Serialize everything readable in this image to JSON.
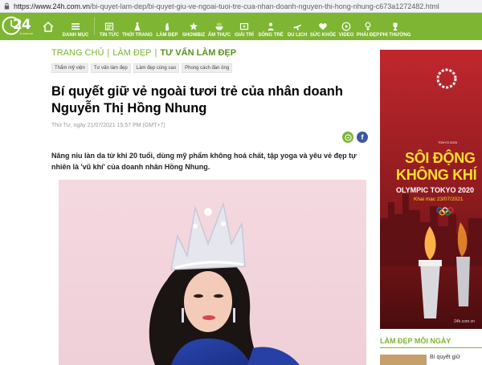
{
  "browser": {
    "url_host": "https://www.24h.com.vn",
    "url_path": "/bi-quyet-lam-dep/bi-quyet-giu-ve-ngoai-tuoi-tre-cua-nhan-doanh-nguyen-thi-hong-nhung-c673a1272482.html"
  },
  "nav": {
    "logo_text": "24",
    "logo_sub": "h.com.vn",
    "menu_label": "DANH MỤC",
    "items": [
      {
        "label": "TIN TỨC",
        "icon": "newspaper-icon"
      },
      {
        "label": "THỜI TRANG",
        "icon": "dress-icon"
      },
      {
        "label": "LÀM ĐẸP",
        "icon": "lipstick-icon"
      },
      {
        "label": "SHOWBIZ",
        "icon": "star-icon"
      },
      {
        "label": "ẨM THỰC",
        "icon": "bowl-icon"
      },
      {
        "label": "GIẢI TRÍ",
        "icon": "film-icon"
      },
      {
        "label": "SỐNG TRẺ",
        "icon": "person-icon"
      },
      {
        "label": "DU LỊCH",
        "icon": "plane-icon"
      },
      {
        "label": "SỨC KHỎE",
        "icon": "heart-icon"
      },
      {
        "label": "VIDEO",
        "icon": "play-icon"
      },
      {
        "label": "PHÁI ĐẸP",
        "icon": "female-icon"
      },
      {
        "label": "PHI THƯỜNG",
        "icon": "trophy-icon"
      }
    ],
    "accent": "#7eb532"
  },
  "breadcrumb": {
    "home": "TRANG CHỦ",
    "section": "LÀM ĐẸP",
    "current": "TƯ VẤN LÀM ĐẸP"
  },
  "tags": [
    "Thẩm mỹ viện",
    "Tư vấn làm đẹp",
    "Làm đẹp cùng sao",
    "Phong cách đàn ông"
  ],
  "article": {
    "title": "Bí quyết giữ vẻ ngoài tươi trẻ của nhân doanh Nguyễn Thị Hồng Nhung",
    "date": "Thứ Tư, ngày 21/07/2021 15:57 PM (GMT+7)",
    "lead": "Nâng niu làn da từ khi 20 tuổi, dùng mỹ phẩm không hoá chất, tập yoga và yêu vẻ đẹp tự nhiên là 'vũ khí' của doanh nhân Hồng Nhung."
  },
  "ad": {
    "brand_small": "TOKYO 2020",
    "line1": "SÔI ĐỘNG",
    "line2": "KHÔNG KHÍ",
    "line3": "OLYMPIC TOKYO 2020",
    "date": "Khai mạc 23/07/2021",
    "site": "24h.com.vn"
  },
  "sidebar": {
    "heading": "LÀM ĐẸP MỖI NGÀY",
    "item1": "Bí quyết giữ"
  }
}
